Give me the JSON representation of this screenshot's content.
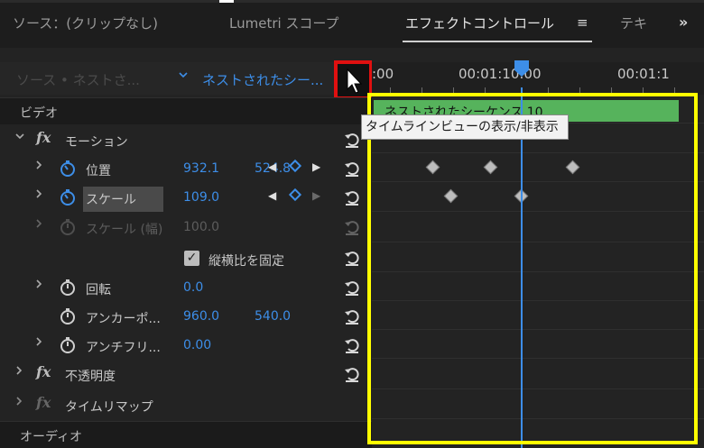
{
  "tabs": {
    "source": "ソース：(クリップなし)",
    "lumetri_scope": "Lumetri スコープ",
    "effect_controls": "エフェクトコントロール",
    "effect_controls_menu": "≡",
    "text_tab": "テキ",
    "overflow": "»"
  },
  "header": {
    "source_label": "ソース • ネストさ...",
    "sequence_chevron": "v",
    "sequence_label": "ネストされたシー...",
    "toggle_button": "タイムラインビューの表示/非表示"
  },
  "sections": {
    "video": "ビデオ",
    "audio": "オーディオ"
  },
  "effects": {
    "motion": {
      "label": "モーション",
      "properties": {
        "position": {
          "label": "位置",
          "x": "932.1",
          "y": "524.8"
        },
        "scale": {
          "label": "スケール",
          "value": "109.0"
        },
        "scale_width": {
          "label": "スケール (幅)",
          "value": "100.0"
        },
        "uniform_scale": {
          "label": "縦横比を固定",
          "checked": true,
          "check": "✓"
        },
        "rotation": {
          "label": "回転",
          "value": "0.0"
        },
        "anchor": {
          "label": "アンカーポ...",
          "x": "960.0",
          "y": "540.0"
        },
        "anti_flicker": {
          "label": "アンチフリ...",
          "value": "0.00"
        }
      }
    },
    "opacity": {
      "label": "不透明度"
    },
    "time_remap": {
      "label": "タイムリマップ"
    }
  },
  "timeline": {
    "timecode_start": ":00",
    "timecode_mid": "00:01:10:00",
    "timecode_end": "00:01:1",
    "clip_title": "ネストされたシーケンス 10",
    "position_keyframes": 3,
    "scale_keyframes": 2
  },
  "tooltip": {
    "text": "タイムラインビューの表示/非表示"
  },
  "colors": {
    "accent_blue": "#3d8ee8",
    "clip_green": "#56b35c",
    "annotation_red": "#e01010",
    "annotation_yellow": "#ffff00"
  },
  "icons": {
    "fx": "fx",
    "expand": "›",
    "expand_open": "⌄",
    "prev_keyframe": "◀",
    "next_keyframe": "▶"
  }
}
